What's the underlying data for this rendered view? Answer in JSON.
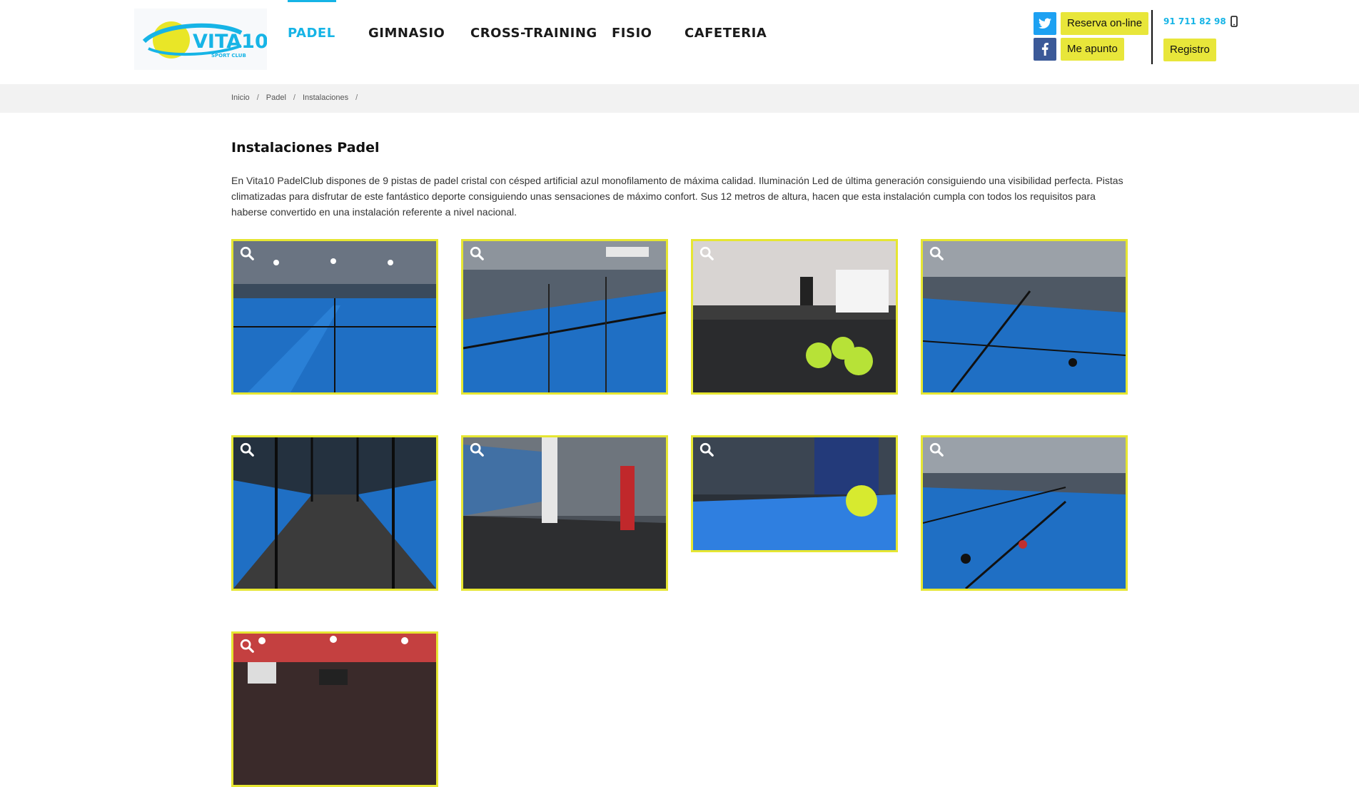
{
  "header": {
    "logo": {
      "text": "VITA10",
      "subtext": "SPORT CLUB"
    },
    "nav": [
      {
        "label": "PADEL",
        "active": true
      },
      {
        "label": "GIMNASIO",
        "active": false
      },
      {
        "label": "CROSS-TRAINING",
        "active": false
      },
      {
        "label": "FISIO",
        "active": false
      },
      {
        "label": "CAFETERIA",
        "active": false
      }
    ],
    "buttons": {
      "reserva": "Reserva on-line",
      "apunto": "Me apunto",
      "registro": "Registro"
    },
    "phone": "91 711 82 98",
    "social": [
      "twitter-icon",
      "facebook-icon"
    ]
  },
  "breadcrumb": [
    "Inicio",
    "Padel",
    "Instalaciones"
  ],
  "content": {
    "title": "Instalaciones Padel",
    "intro": "En Vita10 PadelClub dispones de 9 pistas de padel cristal con césped artificial azul monofilamento de máxima calidad. Iluminación Led de última generación consiguiendo una visibilidad perfecta. Pistas climatizadas para disfrutar de este fantástico deporte consiguiendo unas sensaciones de máximo confort. Sus 12 metros de altura, hacen que esta instalación cumpla con todos los requisitos para haberse convertido en una instalación referente a nivel nacional.",
    "gallery_count": 9
  },
  "colors": {
    "accent": "#16b4e6",
    "button_yellow": "#e8e63a",
    "thumb_border": "#e6e632",
    "court_blue": "#1f6fc4"
  }
}
